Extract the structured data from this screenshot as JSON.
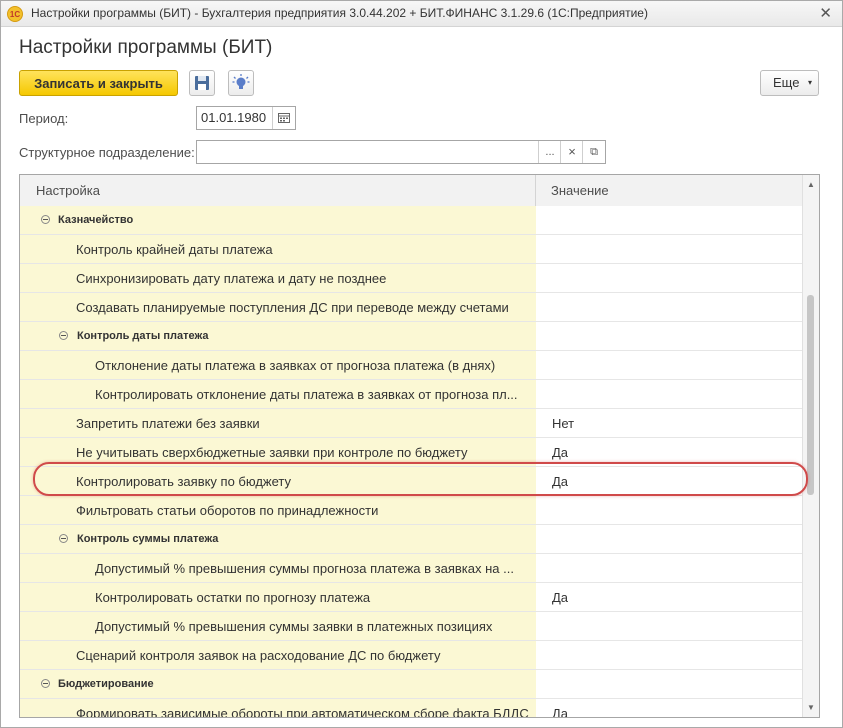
{
  "window": {
    "title": "Настройки программы (БИТ) - Бухгалтерия предприятия 3.0.44.202 + БИТ.ФИНАНС 3.1.29.6  (1С:Предприятие)",
    "logo_text": "1С",
    "close_glyph": "✕"
  },
  "page": {
    "title": "Настройки программы (БИТ)"
  },
  "toolbar": {
    "save_close_label": "Записать и закрыть",
    "save_icon": "floppy-disk-icon",
    "hint_icon": "lightbulb-icon",
    "more_label": "Еще",
    "more_caret": "▾"
  },
  "form": {
    "period_label": "Период:",
    "period_value": "01.01.1980",
    "division_label": "Структурное подразделение:",
    "division_value": "",
    "select_glyph": "...",
    "clear_glyph": "×",
    "open_glyph": "⧉"
  },
  "table": {
    "headers": [
      "Настройка",
      "Значение"
    ],
    "rows": [
      {
        "label": "Казначейство",
        "level": 0,
        "group": true,
        "value": ""
      },
      {
        "label": "Контроль крайней даты платежа",
        "level": 1,
        "group": false,
        "value": ""
      },
      {
        "label": "Синхронизировать дату платежа и дату не позднее",
        "level": 1,
        "group": false,
        "value": ""
      },
      {
        "label": "Создавать планируемые поступления ДС при переводе между счетами",
        "level": 1,
        "group": false,
        "value": ""
      },
      {
        "label": "Контроль даты платежа",
        "level": 1,
        "group": true,
        "value": ""
      },
      {
        "label": "Отклонение даты платежа в заявках от прогноза платежа (в днях)",
        "level": 2,
        "group": false,
        "value": ""
      },
      {
        "label": "Контролировать отклонение даты платежа в заявках от прогноза пл...",
        "level": 2,
        "group": false,
        "value": ""
      },
      {
        "label": "Запретить платежи без заявки",
        "level": 1,
        "group": false,
        "value": "Нет"
      },
      {
        "label": "Не учитывать сверхбюджетные заявки при контроле по бюджету",
        "level": 1,
        "group": false,
        "value": "Да"
      },
      {
        "label": "Контролировать заявку по бюджету",
        "level": 1,
        "group": false,
        "value": "Да"
      },
      {
        "label": "Фильтровать статьи оборотов по принадлежности",
        "level": 1,
        "group": false,
        "value": ""
      },
      {
        "label": "Контроль суммы платежа",
        "level": 1,
        "group": true,
        "value": ""
      },
      {
        "label": "Допустимый % превышения суммы прогноза платежа в заявках на ...",
        "level": 2,
        "group": false,
        "value": ""
      },
      {
        "label": "Контролировать остатки по прогнозу платежа",
        "level": 2,
        "group": false,
        "value": "Да"
      },
      {
        "label": "Допустимый % превышения суммы заявки в платежных позициях",
        "level": 2,
        "group": false,
        "value": ""
      },
      {
        "label": "Сценарий контроля заявок на расходование ДС по бюджету",
        "level": 1,
        "group": false,
        "value": ""
      },
      {
        "label": "Бюджетирование",
        "level": 0,
        "group": true,
        "value": ""
      },
      {
        "label": "Формировать зависимые обороты при автоматическом сборе факта БДДС",
        "level": 1,
        "group": false,
        "value": "Да"
      }
    ],
    "scroll_up": "▲",
    "scroll_down": "▼"
  },
  "colors": {
    "primary_button": "#f5c800",
    "setting_column_bg": "#fbf8d4",
    "highlight_ring": "#d04a4a"
  }
}
